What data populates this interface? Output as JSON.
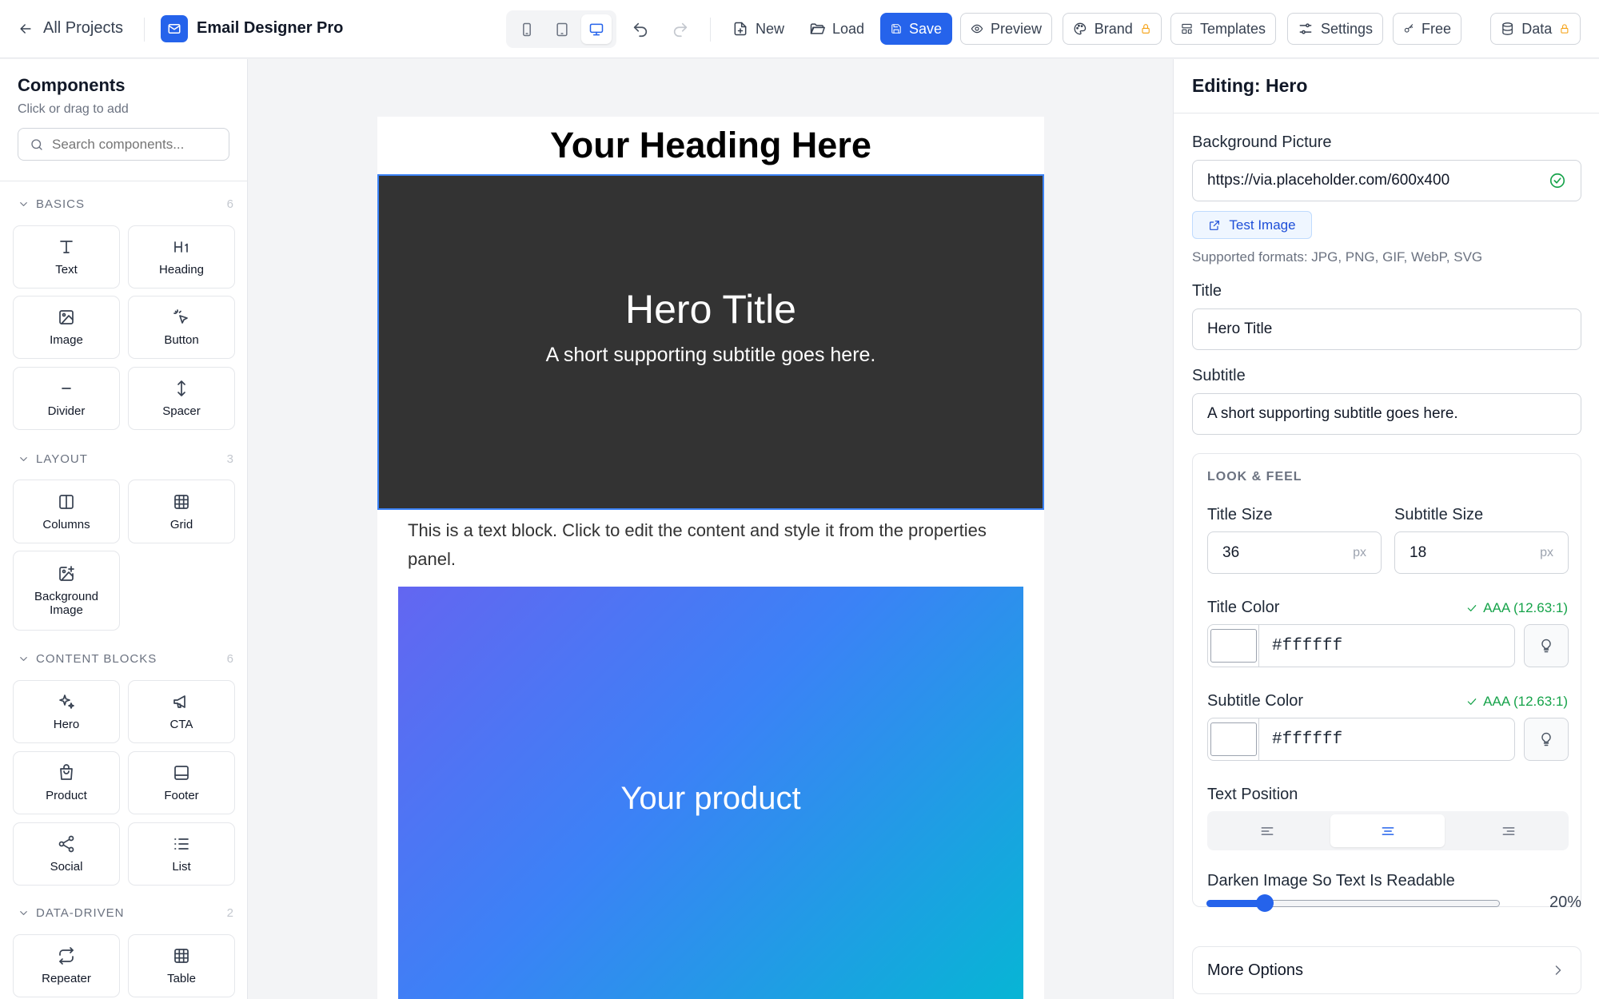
{
  "header": {
    "back_label": "All Projects",
    "app_title": "Email Designer Pro",
    "new_label": "New",
    "load_label": "Load",
    "save_label": "Save",
    "preview_label": "Preview",
    "brand_label": "Brand",
    "templates_label": "Templates",
    "settings_label": "Settings",
    "free_label": "Free",
    "data_label": "Data",
    "active_device": "desktop",
    "accent_color": "#2563eb"
  },
  "sidebar": {
    "title": "Components",
    "subtitle": "Click or drag to add",
    "search_placeholder": "Search components...",
    "sections": [
      {
        "label": "BASICS",
        "count": "6",
        "items": [
          "Text",
          "Heading",
          "Image",
          "Button",
          "Divider",
          "Spacer"
        ]
      },
      {
        "label": "LAYOUT",
        "count": "3",
        "items": [
          "Columns",
          "Grid",
          "Background Image"
        ]
      },
      {
        "label": "CONTENT BLOCKS",
        "count": "6",
        "items": [
          "Hero",
          "CTA",
          "Product",
          "Footer",
          "Social",
          "List"
        ]
      },
      {
        "label": "DATA-DRIVEN",
        "count": "2",
        "items": [
          "Repeater",
          "Table"
        ]
      }
    ]
  },
  "canvas": {
    "heading": "Your Heading Here",
    "hero_title": "Hero Title",
    "hero_subtitle": "A short supporting subtitle goes here.",
    "text_block": "This is a text block. Click to edit the content and style it from the properties panel.",
    "product_label": "Your product"
  },
  "panel": {
    "title": "Editing: Hero",
    "bg_label": "Background Picture",
    "bg_value": "https://via.placeholder.com/600x400",
    "test_image_label": "Test Image",
    "formats_hint": "Supported formats: JPG, PNG, GIF, WebP, SVG",
    "title_label": "Title",
    "title_value": "Hero Title",
    "subtitle_label": "Subtitle",
    "subtitle_value": "A short supporting subtitle goes here.",
    "look_label": "LOOK & FEEL",
    "title_size_label": "Title Size",
    "title_size_value": "36",
    "subtitle_size_label": "Subtitle Size",
    "subtitle_size_value": "18",
    "unit": "px",
    "title_color_label": "Title Color",
    "title_color_contrast": "AAA (12.63:1)",
    "title_color_value": "#ffffff",
    "subtitle_color_label": "Subtitle Color",
    "subtitle_color_contrast": "AAA (12.63:1)",
    "subtitle_color_value": "#ffffff",
    "text_position_label": "Text Position",
    "text_position_selected": "center",
    "darken_label": "Darken Image So Text Is Readable",
    "darken_value": "20%",
    "darken_fraction": 0.2,
    "more_options_label": "More Options"
  }
}
